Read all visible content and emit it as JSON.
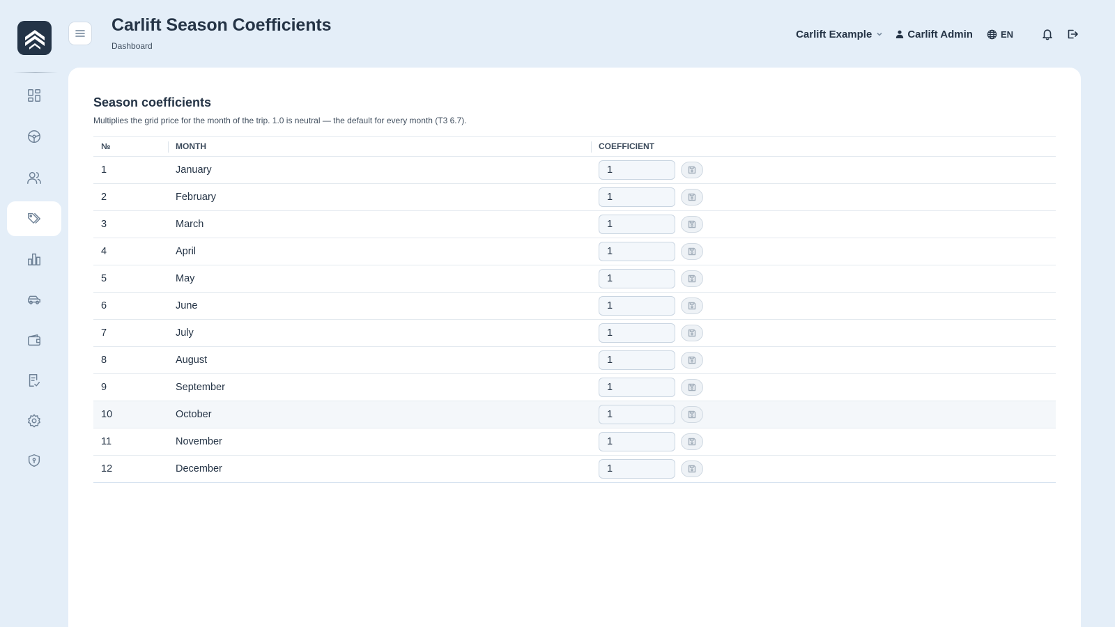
{
  "header": {
    "title": "Carlift Season Coefficients",
    "breadcrumb": "Dashboard",
    "organization": "Carlift Example",
    "user": "Carlift Admin",
    "language": "EN"
  },
  "sidebar": {
    "items": [
      {
        "name": "dashboard",
        "icon": "dashboard-grid-icon",
        "active": false
      },
      {
        "name": "drivers",
        "icon": "steering-wheel-icon",
        "active": false
      },
      {
        "name": "users",
        "icon": "users-icon",
        "active": false
      },
      {
        "name": "pricing",
        "icon": "tags-icon",
        "active": true
      },
      {
        "name": "statistics",
        "icon": "bar-chart-icon",
        "active": false
      },
      {
        "name": "vehicles",
        "icon": "car-icon",
        "active": false
      },
      {
        "name": "wallet",
        "icon": "wallet-icon",
        "active": false
      },
      {
        "name": "reports",
        "icon": "checklist-icon",
        "active": false
      },
      {
        "name": "settings",
        "icon": "gear-icon",
        "active": false
      },
      {
        "name": "security",
        "icon": "shield-icon",
        "active": false
      }
    ]
  },
  "section": {
    "title": "Season coefficients",
    "description": "Multiplies the grid price for the month of the trip. 1.0 is neutral — the default for every month (T3 6.7)."
  },
  "table": {
    "columns": [
      "№",
      "MONTH",
      "COEFFICIENT"
    ],
    "rows": [
      {
        "num": "1",
        "month": "January",
        "coefficient": "1"
      },
      {
        "num": "2",
        "month": "February",
        "coefficient": "1"
      },
      {
        "num": "3",
        "month": "March",
        "coefficient": "1"
      },
      {
        "num": "4",
        "month": "April",
        "coefficient": "1"
      },
      {
        "num": "5",
        "month": "May",
        "coefficient": "1"
      },
      {
        "num": "6",
        "month": "June",
        "coefficient": "1"
      },
      {
        "num": "7",
        "month": "July",
        "coefficient": "1"
      },
      {
        "num": "8",
        "month": "August",
        "coefficient": "1"
      },
      {
        "num": "9",
        "month": "September",
        "coefficient": "1"
      },
      {
        "num": "10",
        "month": "October",
        "coefficient": "1"
      },
      {
        "num": "11",
        "month": "November",
        "coefficient": "1"
      },
      {
        "num": "12",
        "month": "December",
        "coefficient": "1"
      }
    ],
    "save_icon": "save-icon"
  },
  "colors": {
    "background": "#e4eef8",
    "logo": "#243447",
    "text": "#253446",
    "icon": "#6f8297"
  }
}
